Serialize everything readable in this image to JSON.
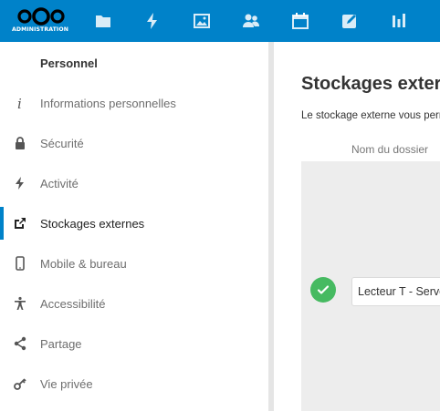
{
  "header": {
    "logo_text": "ADMINISTRATION",
    "brand_color": "#0082c9",
    "apps": [
      {
        "name": "files-icon"
      },
      {
        "name": "activity-icon"
      },
      {
        "name": "photos-icon"
      },
      {
        "name": "contacts-icon"
      },
      {
        "name": "calendar-icon"
      },
      {
        "name": "notes-icon"
      },
      {
        "name": "dashboard-icon"
      }
    ]
  },
  "sidebar": {
    "heading": "Personnel",
    "items": [
      {
        "label": "Informations personnelles",
        "icon": "info-icon"
      },
      {
        "label": "Sécurité",
        "icon": "lock-icon"
      },
      {
        "label": "Activité",
        "icon": "lightning-icon"
      },
      {
        "label": "Stockages externes",
        "icon": "external-link-icon",
        "active": true
      },
      {
        "label": "Mobile & bureau",
        "icon": "phone-icon"
      },
      {
        "label": "Accessibilité",
        "icon": "accessibility-icon"
      },
      {
        "label": "Partage",
        "icon": "share-icon"
      },
      {
        "label": "Vie privée",
        "icon": "key-icon"
      }
    ]
  },
  "main": {
    "title": "Stockages externes",
    "description": "Le stockage externe vous permet",
    "column_header": "Nom du dossier",
    "folder_value": "Lecteur T - Serveur",
    "status_color": "#46ba61"
  }
}
